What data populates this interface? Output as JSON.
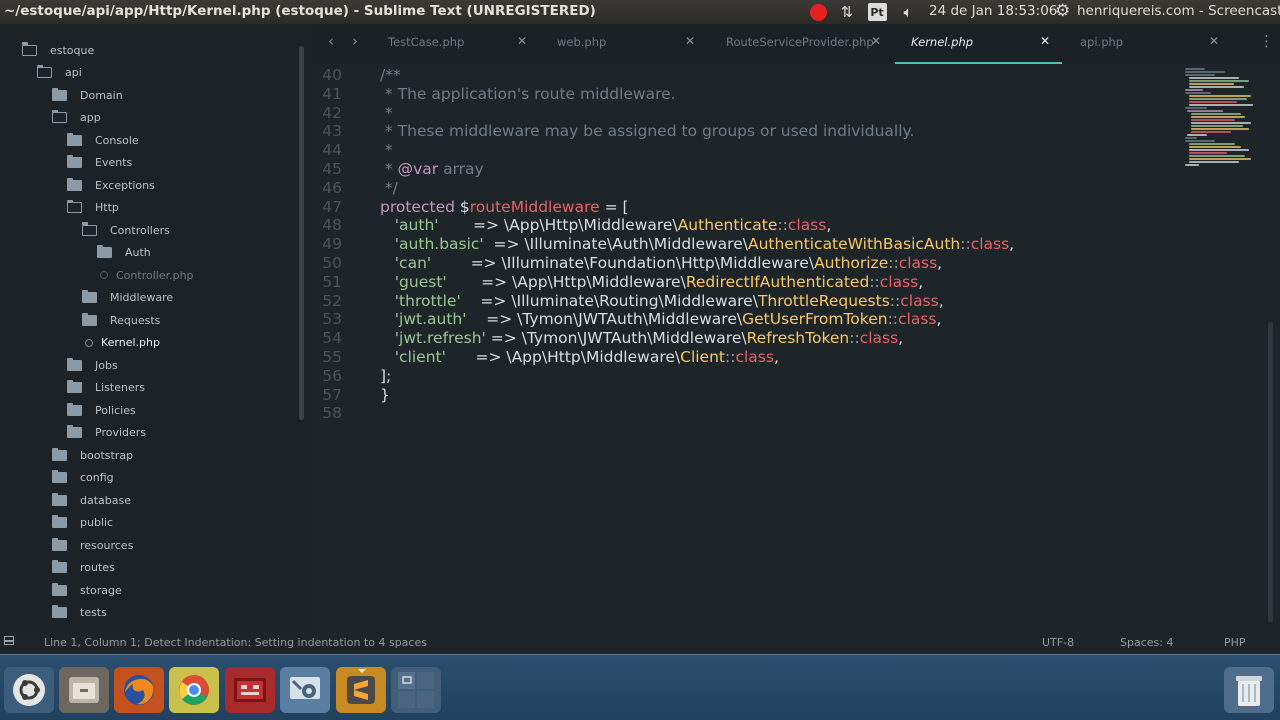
{
  "topbar": {
    "window_title": "~/estoque/api/app/Http/Kernel.php (estoque) - Sublime Text (UNREGISTERED)",
    "keyboard_layout": "Pt",
    "clock": "24 de Jan 18:53:06",
    "user": "henriquereis.com - Screencasts",
    "icons": [
      "record-icon",
      "sync-arrows-icon",
      "keyboard-layout-icon",
      "volume-icon",
      "gear-icon"
    ]
  },
  "sidebar": {
    "items": [
      {
        "label": "estoque",
        "type": "folder-open",
        "depth": 0
      },
      {
        "label": "api",
        "type": "folder-open",
        "depth": 1
      },
      {
        "label": "Domain",
        "type": "folder",
        "depth": 2
      },
      {
        "label": "app",
        "type": "folder-open",
        "depth": 2
      },
      {
        "label": "Console",
        "type": "folder",
        "depth": 3
      },
      {
        "label": "Events",
        "type": "folder",
        "depth": 3
      },
      {
        "label": "Exceptions",
        "type": "folder",
        "depth": 3
      },
      {
        "label": "Http",
        "type": "folder-open",
        "depth": 3
      },
      {
        "label": "Controllers",
        "type": "folder-open",
        "depth": 4
      },
      {
        "label": "Auth",
        "type": "folder",
        "depth": 5
      },
      {
        "label": "Controller.php",
        "type": "file-dim",
        "depth": 5
      },
      {
        "label": "Middleware",
        "type": "folder",
        "depth": 4
      },
      {
        "label": "Requests",
        "type": "folder",
        "depth": 4
      },
      {
        "label": "Kernel.php",
        "type": "file-selected",
        "depth": 4
      },
      {
        "label": "Jobs",
        "type": "folder",
        "depth": 3
      },
      {
        "label": "Listeners",
        "type": "folder",
        "depth": 3
      },
      {
        "label": "Policies",
        "type": "folder",
        "depth": 3
      },
      {
        "label": "Providers",
        "type": "folder",
        "depth": 3
      },
      {
        "label": "bootstrap",
        "type": "folder",
        "depth": 2
      },
      {
        "label": "config",
        "type": "folder",
        "depth": 2
      },
      {
        "label": "database",
        "type": "folder",
        "depth": 2
      },
      {
        "label": "public",
        "type": "folder",
        "depth": 2
      },
      {
        "label": "resources",
        "type": "folder",
        "depth": 2
      },
      {
        "label": "routes",
        "type": "folder",
        "depth": 2
      },
      {
        "label": "storage",
        "type": "folder",
        "depth": 2
      },
      {
        "label": "tests",
        "type": "folder",
        "depth": 2
      }
    ]
  },
  "tabs": [
    {
      "label": "TestCase.php",
      "active": false
    },
    {
      "label": "web.php",
      "active": false
    },
    {
      "label": "RouteServiceProvider.php",
      "active": false
    },
    {
      "label": "Kernel.php",
      "active": true
    },
    {
      "label": "api.php",
      "active": false
    }
  ],
  "editor": {
    "lines": [
      {
        "num": "40",
        "tokens": [
          [
            "comment",
            "/**"
          ]
        ]
      },
      {
        "num": "41",
        "tokens": [
          [
            "comment",
            " * The application's route middleware."
          ]
        ]
      },
      {
        "num": "42",
        "tokens": [
          [
            "comment",
            " *"
          ]
        ]
      },
      {
        "num": "43",
        "tokens": [
          [
            "comment",
            " * These middleware may be assigned to groups or used individually."
          ]
        ]
      },
      {
        "num": "44",
        "tokens": [
          [
            "comment",
            " *"
          ]
        ]
      },
      {
        "num": "45",
        "tokens": [
          [
            "comment",
            " * "
          ],
          [
            "doctag",
            "@var"
          ],
          [
            "comment",
            " array"
          ]
        ]
      },
      {
        "num": "46",
        "tokens": [
          [
            "comment",
            " */"
          ]
        ]
      },
      {
        "num": "47",
        "tokens": [
          [
            "kw",
            "protected"
          ],
          [
            "op",
            " $"
          ],
          [
            "var",
            "routeMiddleware"
          ],
          [
            "op",
            " = ["
          ]
        ]
      },
      {
        "num": "48",
        "tokens": [
          [
            "op",
            "   "
          ],
          [
            "str",
            "'auth'"
          ],
          [
            "op",
            "       => \\App\\Http\\Middleware\\"
          ],
          [
            "cls",
            "Authenticate"
          ],
          [
            "punc",
            "::"
          ],
          [
            "classkw",
            "class"
          ],
          [
            "op",
            ","
          ]
        ]
      },
      {
        "num": "49",
        "tokens": [
          [
            "op",
            "   "
          ],
          [
            "str",
            "'auth.basic'"
          ],
          [
            "op",
            "  => \\Illuminate\\Auth\\Middleware\\"
          ],
          [
            "cls",
            "AuthenticateWithBasicAuth"
          ],
          [
            "punc",
            "::"
          ],
          [
            "classkw",
            "class"
          ],
          [
            "op",
            ","
          ]
        ]
      },
      {
        "num": "50",
        "tokens": [
          [
            "op",
            "   "
          ],
          [
            "str",
            "'can'"
          ],
          [
            "op",
            "        => \\Illuminate\\Foundation\\Http\\Middleware\\"
          ],
          [
            "cls",
            "Authorize"
          ],
          [
            "punc",
            "::"
          ],
          [
            "classkw",
            "class"
          ],
          [
            "op",
            ","
          ]
        ]
      },
      {
        "num": "51",
        "tokens": [
          [
            "op",
            "   "
          ],
          [
            "str",
            "'guest'"
          ],
          [
            "op",
            "       => \\App\\Http\\Middleware\\"
          ],
          [
            "cls",
            "RedirectIfAuthenticated"
          ],
          [
            "punc",
            "::"
          ],
          [
            "classkw",
            "class"
          ],
          [
            "op",
            ","
          ]
        ]
      },
      {
        "num": "52",
        "tokens": [
          [
            "op",
            "   "
          ],
          [
            "str",
            "'throttle'"
          ],
          [
            "op",
            "    => \\Illuminate\\Routing\\Middleware\\"
          ],
          [
            "cls",
            "ThrottleRequests"
          ],
          [
            "punc",
            "::"
          ],
          [
            "classkw",
            "class"
          ],
          [
            "op",
            ","
          ]
        ]
      },
      {
        "num": "53",
        "tokens": [
          [
            "op",
            "   "
          ],
          [
            "str",
            "'jwt.auth'"
          ],
          [
            "op",
            "    => \\Tymon\\JWTAuth\\Middleware\\"
          ],
          [
            "cls",
            "GetUserFromToken"
          ],
          [
            "punc",
            "::"
          ],
          [
            "classkw",
            "class"
          ],
          [
            "op",
            ","
          ]
        ]
      },
      {
        "num": "54",
        "tokens": [
          [
            "op",
            "   "
          ],
          [
            "str",
            "'jwt.refresh'"
          ],
          [
            "op",
            " => \\Tymon\\JWTAuth\\Middleware\\"
          ],
          [
            "cls",
            "RefreshToken"
          ],
          [
            "punc",
            "::"
          ],
          [
            "classkw",
            "class"
          ],
          [
            "op",
            ","
          ]
        ]
      },
      {
        "num": "55",
        "tokens": [
          [
            "op",
            "   "
          ],
          [
            "str",
            "'client'"
          ],
          [
            "op",
            "      => \\App\\Http\\Middleware\\"
          ],
          [
            "cls",
            "Client"
          ],
          [
            "punc",
            "::"
          ],
          [
            "classkw",
            "class"
          ],
          [
            "op",
            ","
          ]
        ]
      },
      {
        "num": "56",
        "tokens": [
          [
            "op",
            "];"
          ]
        ]
      },
      {
        "num": "57",
        "tokens": [
          [
            "op",
            "}"
          ]
        ]
      },
      {
        "num": "58",
        "tokens": []
      }
    ]
  },
  "statusbar": {
    "text": "Line 1, Column 1; Detect Indentation: Setting indentation to 4 spaces",
    "encoding": "UTF-8",
    "spaces": "Spaces: 4",
    "syntax": "PHP"
  },
  "dock": {
    "items": [
      "ubuntu-logo-icon",
      "files-icon",
      "firefox-icon",
      "chrome-icon",
      "screencast-recorder-icon",
      "system-settings-icon",
      "sublime-text-icon",
      "workspaces-icon",
      "trash-icon"
    ]
  },
  "colors": {
    "accent_tab_underline": "#4dc1b5",
    "keyword": "#c594c5",
    "string": "#99c794",
    "class_name": "#fac863",
    "variable": "#ec5f67"
  }
}
